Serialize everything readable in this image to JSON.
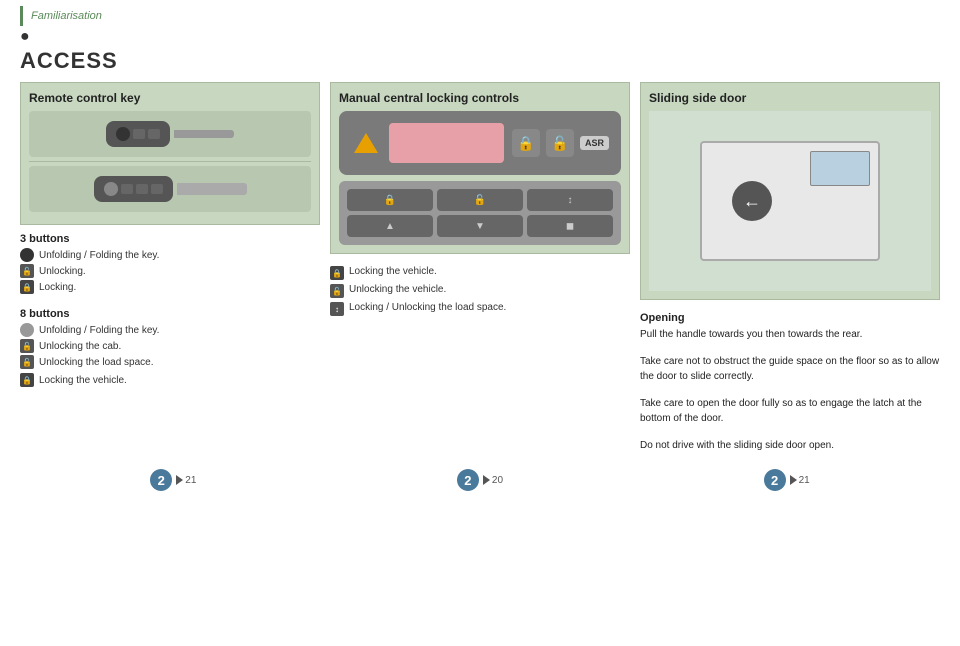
{
  "topbar": {
    "text": "Familiarisation"
  },
  "section": {
    "title": "ACCESS"
  },
  "panel1": {
    "title": "Remote control key",
    "desc3_title": "3 buttons",
    "desc3_items": [
      "Unfolding / Folding the key.",
      "Unlocking.",
      "Locking."
    ],
    "desc8_title": "8 buttons",
    "desc8_items": [
      "Unfolding / Folding the key.",
      "Unlocking the cab.",
      "Unlocking the load space."
    ],
    "desc8_extra": "Locking the vehicle."
  },
  "panel2": {
    "title": "Manual central locking controls",
    "items": [
      "Locking the vehicle.",
      "Unlocking the vehicle.",
      "Locking / Unlocking the load space."
    ]
  },
  "panel3": {
    "title": "Sliding side door",
    "opening_title": "Opening",
    "opening_lines": [
      "Pull the handle towards you then towards the rear.",
      "Take care not to obstruct the guide space on the floor so as to allow the door to slide correctly.",
      "Take care to open the door fully so as to engage the latch at the bottom of the door.",
      "Do not drive with the sliding side door open."
    ]
  },
  "navigation": [
    {
      "page": "2",
      "ref": "21"
    },
    {
      "page": "2",
      "ref": "20"
    },
    {
      "page": "2",
      "ref": "21"
    }
  ]
}
